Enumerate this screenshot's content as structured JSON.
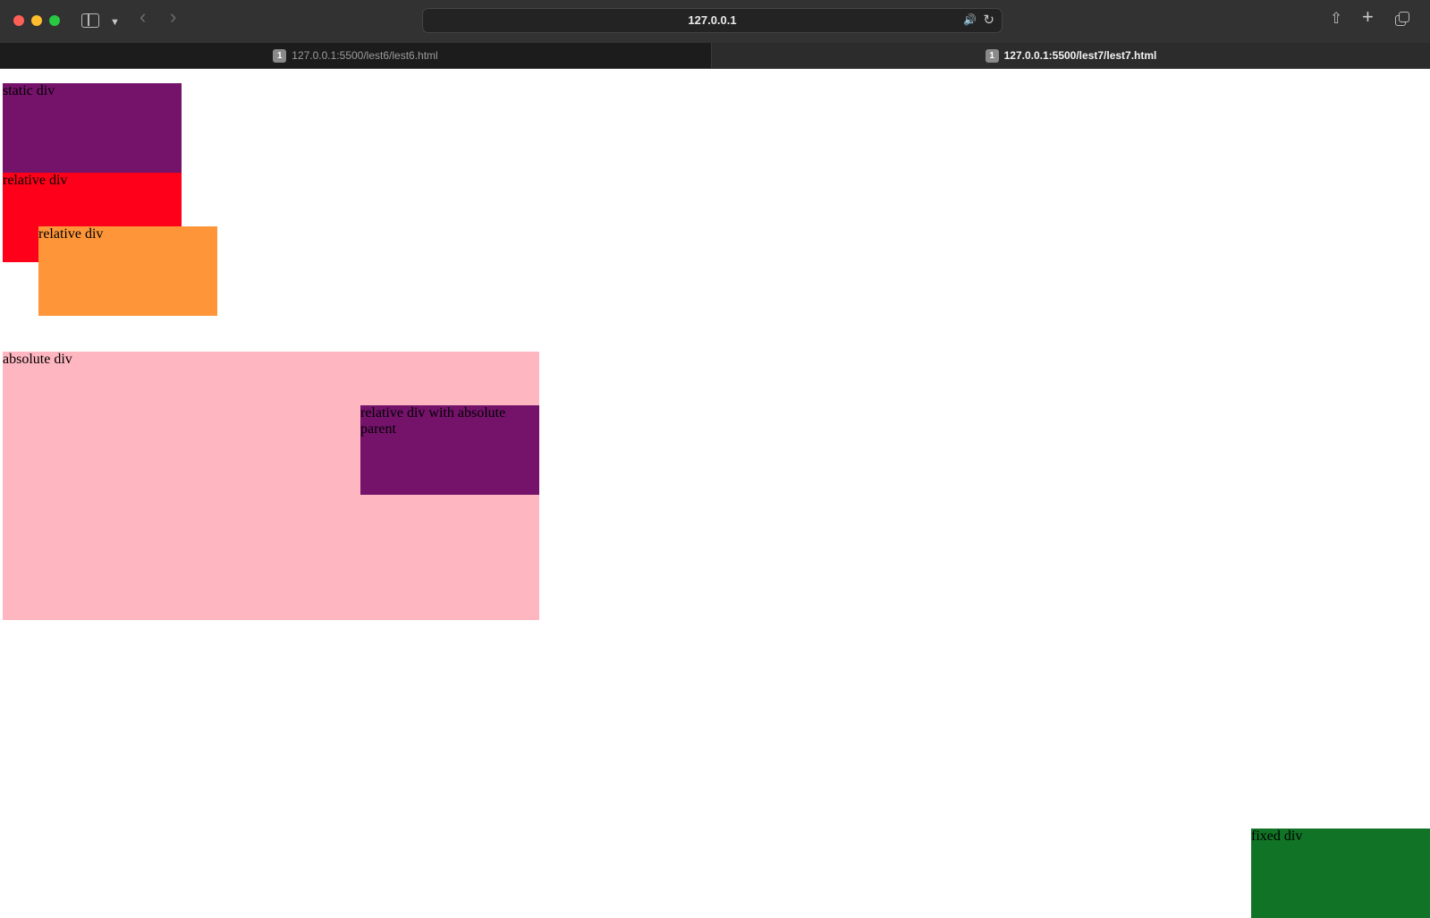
{
  "browser": {
    "address": "127.0.0.1",
    "tabs": [
      {
        "label": "127.0.0.1:5500/lest6/lest6.html",
        "badge": "1",
        "active": false
      },
      {
        "label": "127.0.0.1:5500/lest7/lest7.html",
        "badge": "1",
        "active": true
      }
    ]
  },
  "icons": {
    "sidebar": "sidebar-icon",
    "chevron": "chevron-down-icon",
    "back": "back-arrow-icon",
    "forward": "forward-arrow-icon",
    "speaker": "speaker-icon",
    "reload": "reload-icon",
    "share": "share-icon",
    "new_tab": "plus-icon",
    "tab_overview": "tab-overview-icon"
  },
  "page": {
    "boxes": {
      "static": {
        "label": "static div",
        "color": "#75136b"
      },
      "relative_1": {
        "label": "relative div",
        "color": "#fe001a"
      },
      "relative_2": {
        "label": "relative div",
        "color": "#fe9639"
      },
      "absolute": {
        "label": "absolute div",
        "color": "#feb6c1"
      },
      "relative_abs_parent": {
        "label": "relative div with absolute parent",
        "color": "#75136b"
      },
      "fixed": {
        "label": "fixed div",
        "color": "#107325"
      }
    }
  }
}
